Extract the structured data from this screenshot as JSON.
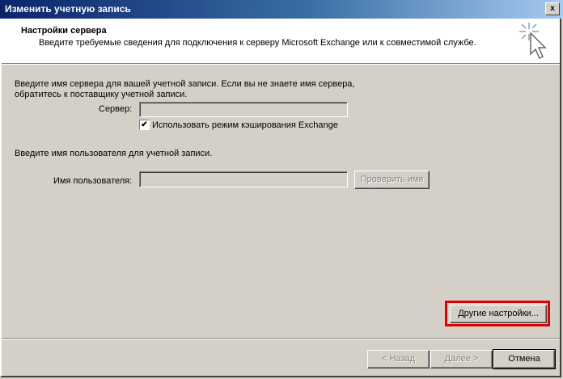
{
  "window": {
    "title": "Изменить учетную запись",
    "close_glyph": "x"
  },
  "header": {
    "title": "Настройки сервера",
    "subtitle": "Введите требуемые сведения для подключения к серверу Microsoft Exchange или к совместимой службе.",
    "icon": "wizard-cursor-icon"
  },
  "server_section": {
    "instruction_line1": "Введите имя сервера для вашей учетной записи. Если вы не знаете имя сервера,",
    "instruction_line2": "обратитесь к поставщику учетной записи.",
    "server_label": "Сервер:",
    "server_value": "",
    "cache_checkbox_label": "Использовать режим кэширования Exchange",
    "cache_checked": true,
    "check_glyph": "✔"
  },
  "user_section": {
    "instruction": "Введите имя пользователя для учетной записи.",
    "username_label": "Имя пользователя:",
    "username_value": "",
    "check_name_button": "Проверить имя"
  },
  "buttons": {
    "more_settings": "Другие настройки...",
    "back": "< Назад",
    "next": "Далее >",
    "cancel": "Отмена"
  },
  "colors": {
    "highlight": "#e00000",
    "window_bg": "#d4d0c8"
  }
}
